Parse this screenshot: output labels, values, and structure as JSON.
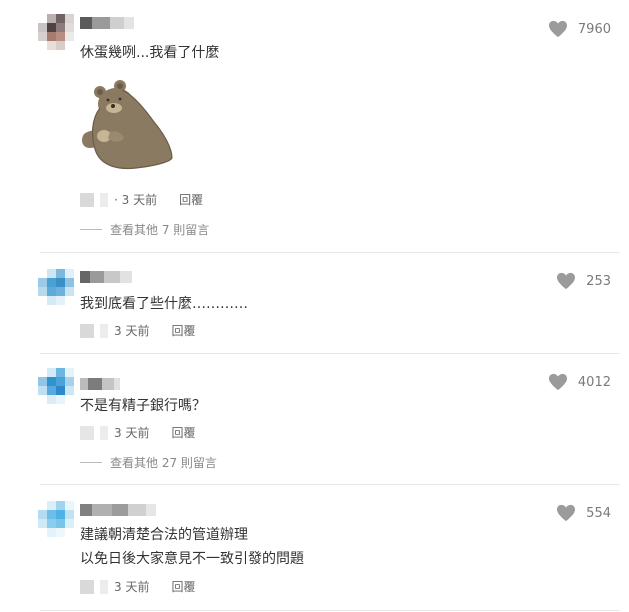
{
  "comments": [
    {
      "text": "休蛋幾咧...我看了什麼",
      "likes": "7960",
      "time_prefix": "· ",
      "time": "3 天前",
      "reply": "回覆",
      "more_replies": "查看其他 7 則留言",
      "has_sticker": true,
      "sticker": "bear-sticker"
    },
    {
      "text": "我到底看了些什麼…………",
      "likes": "253",
      "time": "3 天前",
      "reply": "回覆"
    },
    {
      "text": "不是有精子銀行嗎？",
      "likes": "4012",
      "time": "3 天前",
      "reply": "回覆",
      "more_replies": "查看其他 27 則留言"
    },
    {
      "text_lines": [
        "建議朝清楚合法的管道辦理",
        "以免日後大家意見不一致引發的問題"
      ],
      "likes": "554",
      "time": "3 天前",
      "reply": "回覆"
    }
  ],
  "icons": {
    "like": "heart-icon"
  },
  "colors": {
    "heart": "#9b9b9b",
    "text": "#333333",
    "muted": "#888888",
    "divider": "#e8e8e8"
  }
}
